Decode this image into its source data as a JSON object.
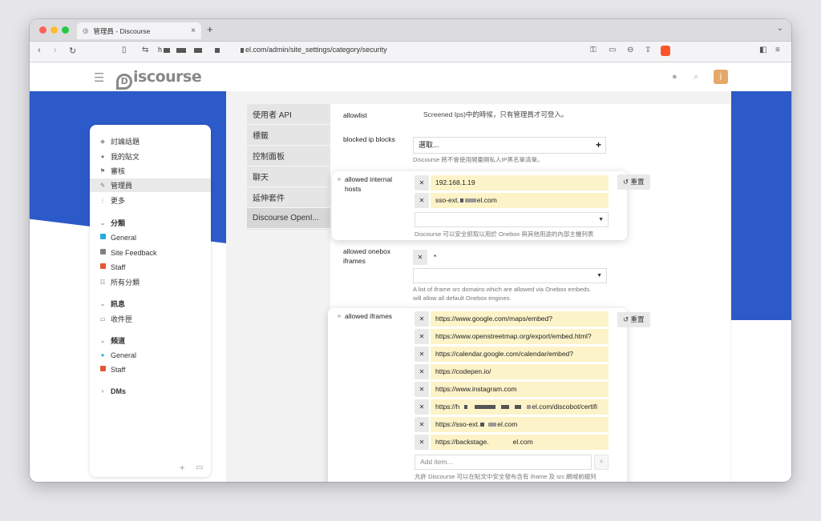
{
  "browser": {
    "tab_title": "管理員 - Discourse",
    "url_prefix": "h",
    "url_suffix": "el.com/admin/site_settings/category/security"
  },
  "header": {
    "logo_text": "iscourse",
    "logo_letter": "D",
    "avatar_letter": "j"
  },
  "sidebar": {
    "items": [
      {
        "label": "討論話題",
        "icon": "layers-icon"
      },
      {
        "label": "我的貼文",
        "icon": "user-icon"
      },
      {
        "label": "審核",
        "icon": "flag-icon"
      },
      {
        "label": "管理員",
        "icon": "wrench-icon"
      },
      {
        "label": "更多",
        "icon": "ellipsis-icon"
      }
    ],
    "categories_title": "分類",
    "categories": [
      {
        "label": "General",
        "color": "#25aae1"
      },
      {
        "label": "Site Feedback",
        "color": "#808281"
      },
      {
        "label": "Staff",
        "color": "#e45735"
      },
      {
        "label": "所有分類",
        "color": ""
      }
    ],
    "messages_title": "訊息",
    "messages": [
      {
        "label": "收件匣"
      }
    ],
    "channels_title": "頻道",
    "channels": [
      {
        "label": "General",
        "color": "#25aae1"
      },
      {
        "label": "Staff",
        "color": "#e45735"
      }
    ],
    "dms_title": "DMs"
  },
  "admin_nav": [
    "使用者 API",
    "標籤",
    "控制面板",
    "聊天",
    "延伸套件",
    "Discourse OpenI..."
  ],
  "settings": {
    "allowlist": {
      "label": "allowlist",
      "note": "Screened Ips)中的時候，只有管理員才可登入。"
    },
    "blocked_ip": {
      "label": "blocked ip blocks",
      "button": "選取...",
      "desc": "Discourse 將不會使用開臺開私人IP黑名單清單。"
    },
    "internal_hosts": {
      "label1": "allowed internal",
      "label2": "hosts",
      "values": [
        "192.168.1.19",
        "sso-ext.",
        "el.com"
      ],
      "desc": "Discourse 可以安全抓取以用於 Onebox 與其他用途的內部主機列表",
      "reset": "重置"
    },
    "onebox_iframes": {
      "label1": "allowed onebox",
      "label2": "iframes",
      "value": "*",
      "desc1": "A list of iframe src domains which are allowed via Onebox embeds.",
      "desc2": "will allow all default Onebox engines."
    },
    "iframes": {
      "label": "allowed iframes",
      "values": [
        "https://www.google.com/maps/embed?",
        "https://www.openstreetmap.org/export/embed.html?",
        "https://calendar.google.com/calendar/embed?",
        "https://codepen.io/",
        "https://www.instagram.com",
        "https://h",
        "https://sso-ext.",
        "https://backstage."
      ],
      "suffixes": [
        "el.com/discobot/certifi",
        "el.com",
        "el.com"
      ],
      "add_placeholder": "Add item...",
      "desc1": "允許 Discourse 可以在貼文中安全發布含有 iframe 及 src 網域前綴列",
      "desc2": "表",
      "reset": "重置"
    }
  }
}
